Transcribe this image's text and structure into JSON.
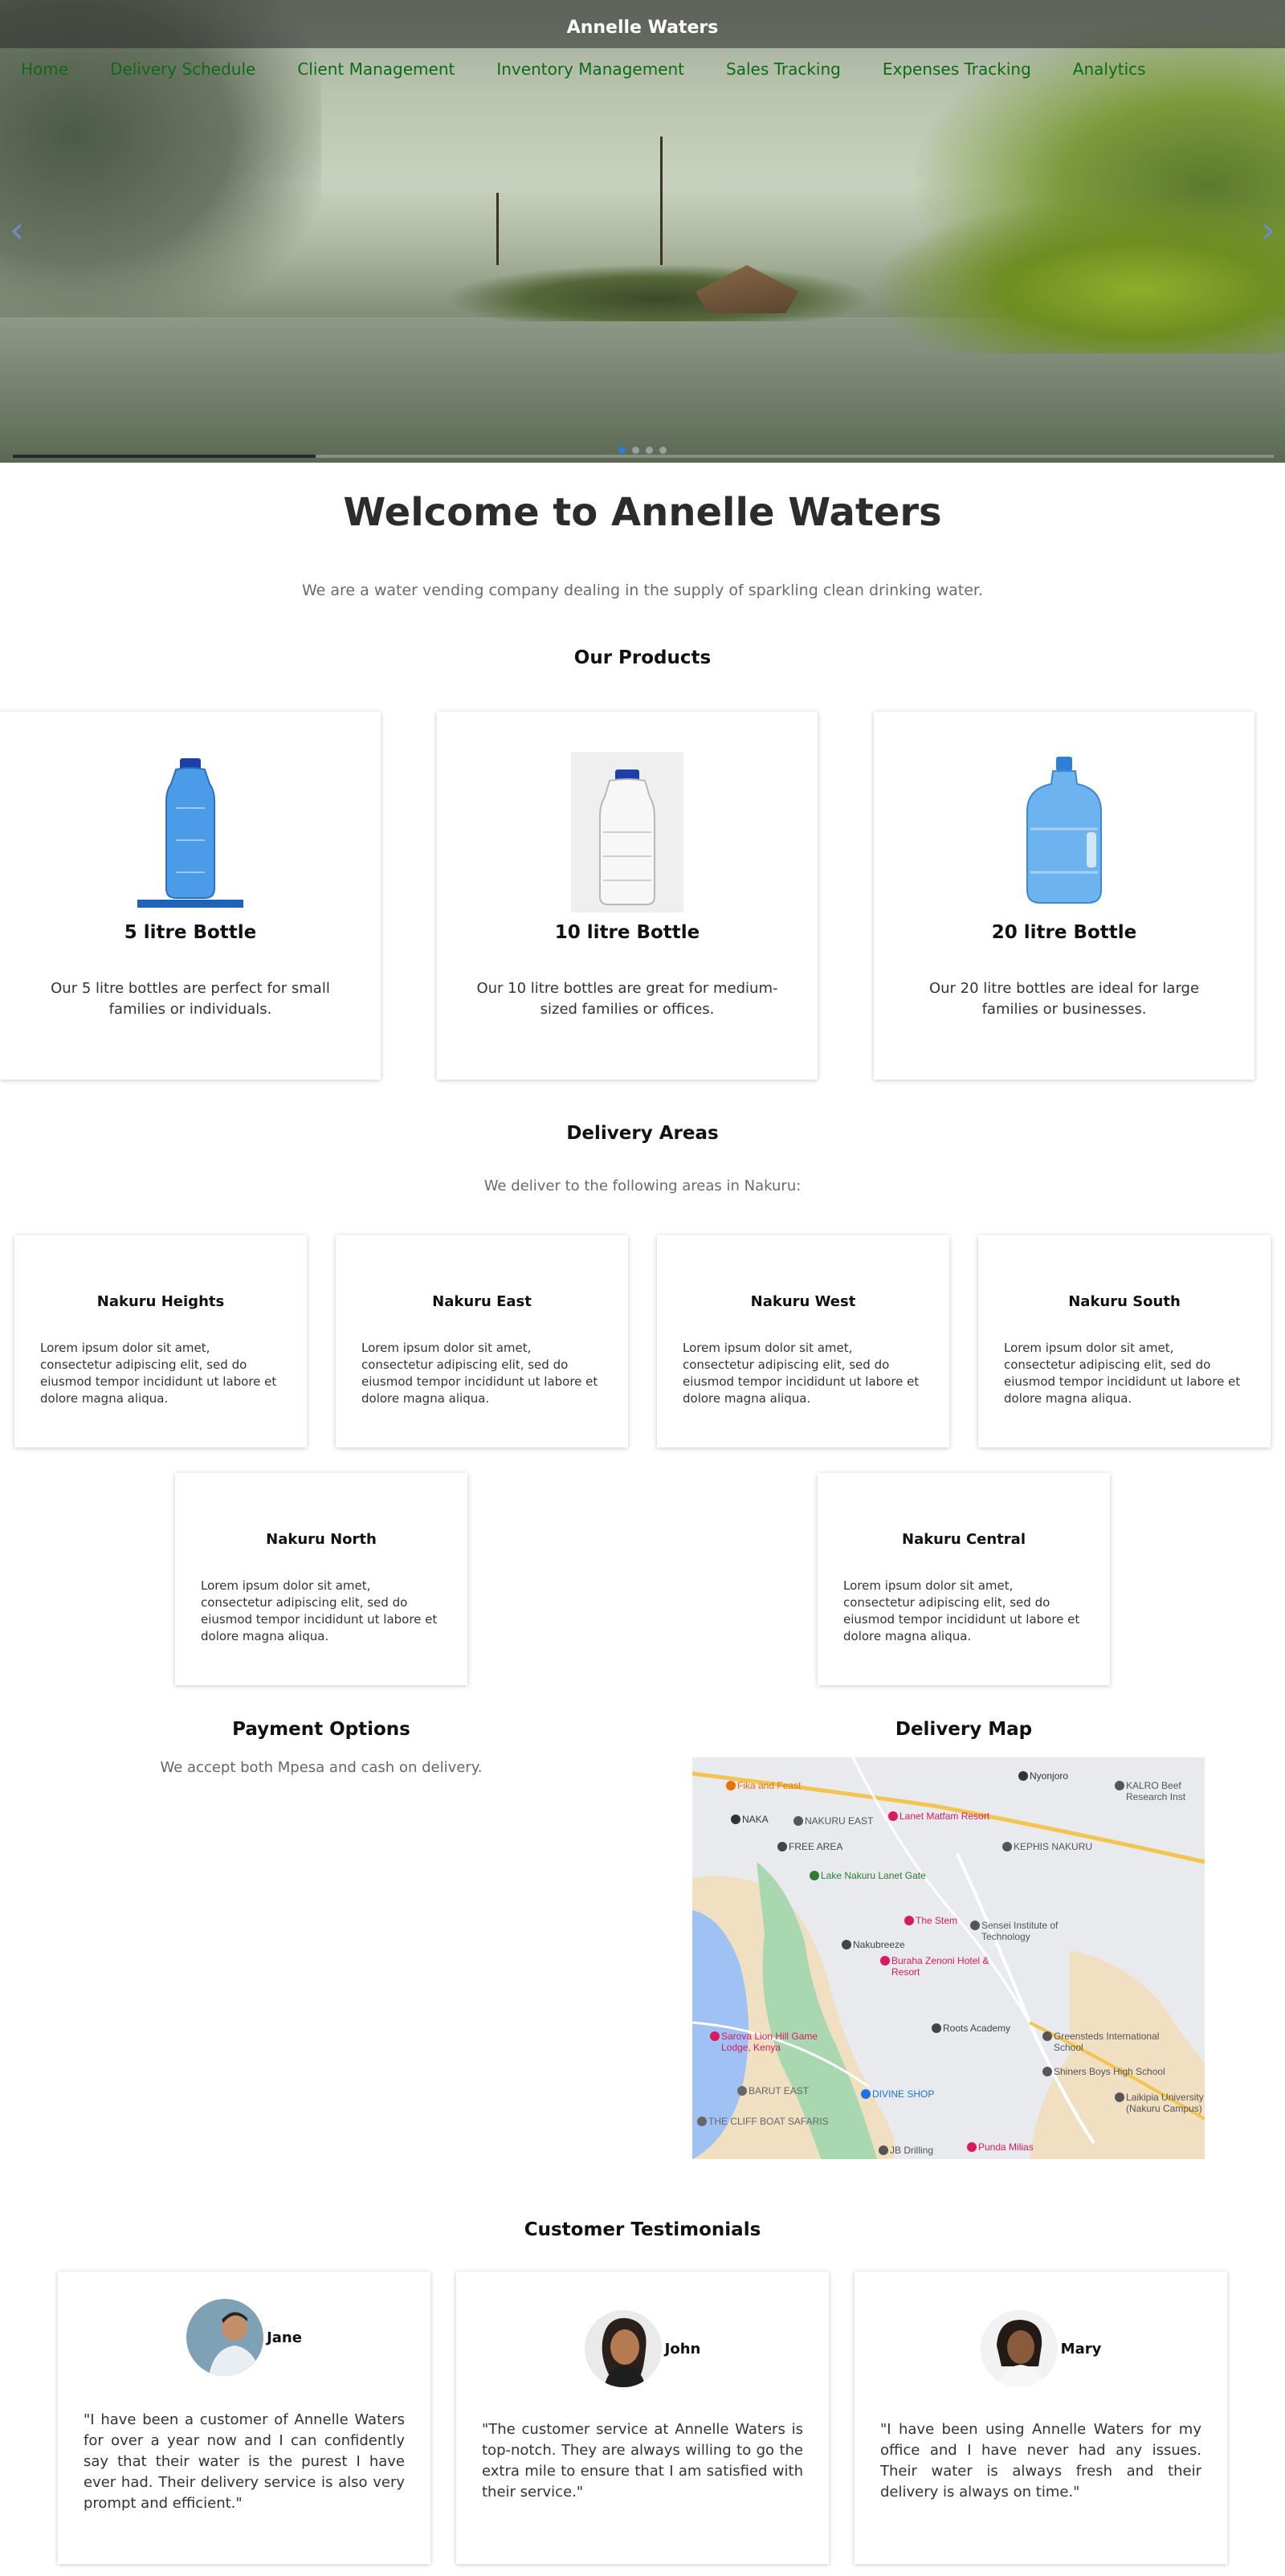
{
  "brand": "Annelle Waters",
  "nav": [
    "Home",
    "Delivery Schedule",
    "Client Management",
    "Inventory Management",
    "Sales Tracking",
    "Expenses Tracking",
    "Analytics"
  ],
  "carousel": {
    "prev_icon": "chevron-left-icon",
    "next_icon": "chevron-right-icon",
    "slides": 4,
    "active_slide": 1,
    "progress": 0.24
  },
  "welcome": {
    "title": "Welcome to Annelle Waters",
    "intro": "We are a water vending company dealing in the supply of sparkling clean drinking water."
  },
  "products": {
    "heading": "Our Products",
    "items": [
      {
        "name": "5 litre Bottle",
        "description": "Our 5 litre bottles are perfect for small families or individuals."
      },
      {
        "name": "10 litre Bottle",
        "description": "Our 10 litre bottles are great for medium-sized families or offices."
      },
      {
        "name": "20 litre Bottle",
        "description": "Our 20 litre bottles are ideal for large families or businesses."
      }
    ]
  },
  "delivery": {
    "heading": "Delivery Areas",
    "intro": "We deliver to the following areas in Nakuru:",
    "areas": [
      {
        "name": "Nakuru Heights",
        "text": "Lorem ipsum dolor sit amet, consectetur adipiscing elit, sed do eiusmod tempor incididunt ut labore et dolore magna aliqua."
      },
      {
        "name": "Nakuru East",
        "text": "Lorem ipsum dolor sit amet, consectetur adipiscing elit, sed do eiusmod tempor incididunt ut labore et dolore magna aliqua."
      },
      {
        "name": "Nakuru West",
        "text": "Lorem ipsum dolor sit amet, consectetur adipiscing elit, sed do eiusmod tempor incididunt ut labore et dolore magna aliqua."
      },
      {
        "name": "Nakuru South",
        "text": "Lorem ipsum dolor sit amet, consectetur adipiscing elit, sed do eiusmod tempor incididunt ut labore et dolore magna aliqua."
      },
      {
        "name": "Nakuru North",
        "text": "Lorem ipsum dolor sit amet, consectetur adipiscing elit, sed do eiusmod tempor incididunt ut labore et dolore magna aliqua."
      },
      {
        "name": "Nakuru Central",
        "text": "Lorem ipsum dolor sit amet, consectetur adipiscing elit, sed do eiusmod tempor incididunt ut labore et dolore magna aliqua."
      }
    ]
  },
  "payment": {
    "heading": "Payment Options",
    "text": "We accept both Mpesa and cash on delivery."
  },
  "map": {
    "heading": "Delivery Map",
    "labels": [
      "Fika and Feast",
      "Nyonjoro",
      "KALRO Beef Research Inst",
      "NAKA",
      "NAKURU EAST",
      "Lanet Matfam Resort",
      "FREE AREA",
      "KEPHIS NAKURU",
      "Lake Nakuru Lanet Gate",
      "The Stem",
      "Sensei Institute of Technology",
      "Nakubreeze",
      "Buraha Zenoni Hotel & Resort",
      "Roots Academy",
      "Greensteds International School",
      "Sarova Lion Hill Game Lodge, Kenya",
      "Shiners Boys High School",
      "DIVINE SHOP",
      "BARUT EAST",
      "Laikipia University (Nakuru Campus)",
      "THE CLIFF BOAT SAFARIS",
      "Punda Milias",
      "JB Drilling"
    ]
  },
  "testimonials": {
    "heading": "Customer Testimonials",
    "items": [
      {
        "name": "Jane",
        "quote": "\"I have been a customer of Annelle Waters for over a year now and I can confidently say that their water is the purest I have ever had. Their delivery service is also very prompt and efficient.\""
      },
      {
        "name": "John",
        "quote": "\"The customer service at Annelle Waters is top-notch. They are always willing to go the extra mile to ensure that I am satisfied with their service.\""
      },
      {
        "name": "Mary",
        "quote": "\"I have been using Annelle Waters for my office and I have never had any issues. Their water is always fresh and their delivery is always on time.\""
      }
    ]
  }
}
